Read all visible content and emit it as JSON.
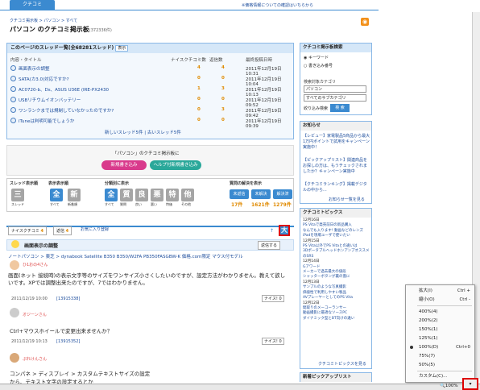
{
  "header": {
    "tab": "クチコミ",
    "notice": "※価格情報についての確認はいちらから",
    "breadcrumb": "クチコミ掲示板 > パソコン > すべて",
    "title": "パソコン のクチコミ掲示板",
    "title_count": "(372336件)",
    "rss": "RSS"
  },
  "threads": {
    "heading": "このページのスレッド一覧(全68281スレッド)",
    "toggle": "表示",
    "col_title": "内容・タイトル",
    "col_reply": "ナイスクチコミ数",
    "col_count": "返信数",
    "col_date": "最終投稿日時",
    "rows": [
      {
        "title": "画面表示の調整",
        "nice": "4",
        "reply": "4",
        "date": "2011年12月19日 10:31"
      },
      {
        "title": "SATA(カ3.0)対応ですか?",
        "nice": "0",
        "reply": "0",
        "date": "2011年12月19日 10:04"
      },
      {
        "title": "AC0720-b、Ds、ASUS U36E (IRE-PX2430",
        "nice": "1",
        "reply": "3",
        "date": "2011年12月19日 10:13"
      },
      {
        "title": "USBリチウムイオンバッテリー",
        "nice": "0",
        "reply": "0",
        "date": "2011年12月19日 09:52"
      },
      {
        "title": "ワンランクまでは規制していなかったのですか?",
        "nice": "0",
        "reply": "3",
        "date": "2011年12月19日 09:42"
      },
      {
        "title": "iTuneは判明可能でしょうか",
        "nice": "0",
        "reply": "0",
        "date": "2011年12月19日 09:39"
      }
    ],
    "pager": "新しいスレッド5件 | 古いスレッド5件"
  },
  "cta": {
    "text": "「パソコン」のクチコミ掲示板に",
    "new": "新規書き込み",
    "help": "ヘルプ付新規書き込み"
  },
  "filter": {
    "h1": "スレッド表示順",
    "h2": "表示表示順",
    "h3": "分類別に表示",
    "h4": "質問の解決を表示",
    "sort": [
      {
        "g": "三",
        "l": "スレッド"
      }
    ],
    "v1": [
      {
        "g": "全",
        "l": "すべて"
      },
      {
        "g": "新",
        "l": "新着順"
      }
    ],
    "cat": [
      {
        "g": "全",
        "l": "すべて"
      },
      {
        "g": "質",
        "l": "質問"
      },
      {
        "g": "良",
        "l": "良い"
      },
      {
        "g": "悪",
        "l": "悪い"
      },
      {
        "g": "特",
        "l": "特価"
      },
      {
        "g": "他",
        "l": "その他"
      }
    ],
    "q": [
      {
        "label": "未返信",
        "n": "17件"
      },
      {
        "label": "未解決",
        "n": "1621件"
      },
      {
        "label": "解決済",
        "n": "1279件"
      }
    ]
  },
  "view": {
    "nice": "ナイスクチコミ",
    "nice_n": "4",
    "reply": "返信",
    "reply_n": "4",
    "fav": "お気に入り登録",
    "big": "大"
  },
  "post": {
    "title": "画面表示の調整",
    "reply_btn": "返信する",
    "path": "ノートパソコン > 東芝 > dynabook Satellite B350 B350/W2FA PB350FASGBW-K 価格.com限定 マウス付モデル",
    "user": "ひ1おの4さん",
    "body": "画面(ネット 接続時)の表示文字等のサイズをワンサイズ小さくしたいのですが、設定方法がわかりません。教えて欲しいです。XPでは調整出来たのですが、7ではわかりません。",
    "date": "2011/12/19 10:00",
    "id": "[13915338]",
    "nice": "ナイス! 0",
    "p2user": "オジーンさん",
    "p2body": "Ctrl+マウスホイールで変更出来ませんか？",
    "p2date": "2011/12/19 10:13",
    "p2id": "[13915352]",
    "p2nice": "ナイス! 0",
    "p3user": "ぷれけんさん",
    "p3body": "コンパネ > ディスプレイ > カスタムテキストサイズの設定",
    "p3more": "から、テキスト文字の設定するとか"
  },
  "side": {
    "search_h": "クチコミ掲示板検索",
    "kw": "キーワード",
    "writer": "書き込み番号",
    "cat_label": "検索対象カテゴリ",
    "cat": "パソコン",
    "sub": "すべてのサブカテゴリ",
    "word_label": "絞り込み検索",
    "search_btn": "検 索",
    "news_h": "お知らせ",
    "news": [
      "【レビュー】家電製品5商品から最大1万円ポイントで試用をキャンペーン実施中！",
      "【ピックアップリスト】関連商品をお探しの方は、もうチェックされましたか？キャンペーン実施中",
      "【クチコミランキング】掲載デジタルの中から..."
    ],
    "more": "お知らせ一覧を見る",
    "topics_h": "クチコミトピックス",
    "topics": [
      {
        "d": "12月16日",
        "t": "PS Vitaで発売前日の新品購入"
      },
      {
        "d": "",
        "t": "なんでも入ります! 動画などのレンズ"
      },
      {
        "d": "",
        "t": "iPadを現場ユーザで使いたい"
      },
      {
        "d": "12月15日",
        "t": "PS Vita以外でPS Vitaとの違いは"
      },
      {
        "d": "",
        "t": "3DポータブルヘッドホンアンプオススメのSRS"
      },
      {
        "d": "12月14日",
        "t": "Gアワード"
      },
      {
        "d": "",
        "t": "メーカーで過去最大の値段"
      },
      {
        "d": "",
        "t": "シャッターボタンが裏の蓋に"
      },
      {
        "d": "12月13日",
        "t": "サンプルのような写真撮影"
      },
      {
        "d": "",
        "t": "価値性で利用しやすい製品"
      },
      {
        "d": "",
        "t": "AVプレーヤーとしてのPS Vita"
      },
      {
        "d": "12月12日",
        "t": "間取りのメーコーランサー"
      },
      {
        "d": "",
        "t": "動画撮影に最適なソースPC"
      },
      {
        "d": "",
        "t": "ダイナミック型とBT向けの違い"
      }
    ],
    "topics_more": "クチコミトピックスを見る",
    "pickup": "新着ピックアップリスト"
  },
  "zoom_menu": {
    "zoom_in": "拡大(I)",
    "zoom_in_k": "Ctrl +",
    "zoom_out": "縮小(O)",
    "zoom_out_k": "Ctrl -",
    "items": [
      "400%(4)",
      "200%(2)",
      "150%(1)",
      "125%(1)",
      "100%(D)",
      "75%(7)",
      "50%(5)"
    ],
    "selected_k": "Ctrl+0",
    "custom": "カスタム(C)..."
  },
  "status": {
    "zoom": "100%"
  }
}
